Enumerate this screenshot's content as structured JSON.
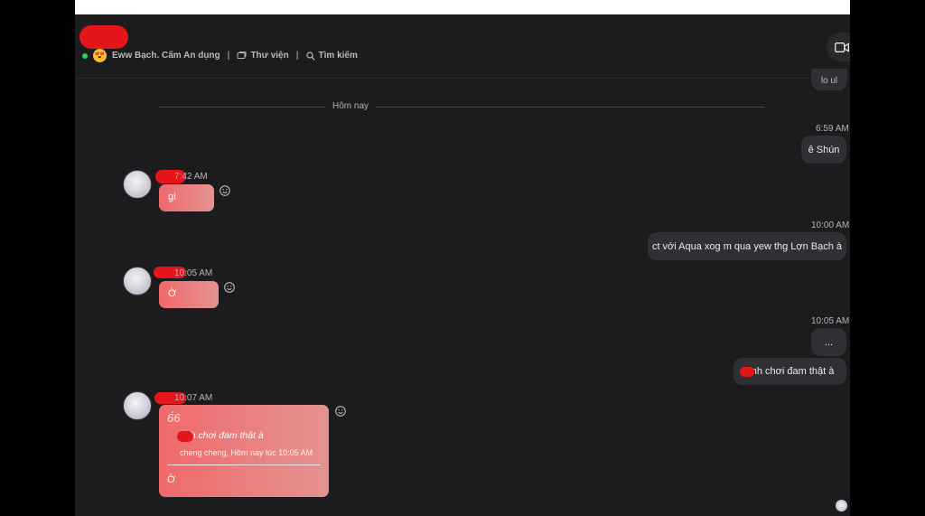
{
  "header": {
    "status": "Eww Bạch. Cấm An dụng",
    "status_emoji": "😍",
    "separator": "|",
    "library_label": "Thư viện",
    "search_label": "Tìm kiếm",
    "partial_message": "lo ul"
  },
  "date_divider": "Hôm nay",
  "messages": {
    "m1_time": "6:59 AM",
    "m1_text": "ê Shún",
    "m2_time": "7:42 AM",
    "m2_text": "gì",
    "m3_time": "10:00 AM",
    "m3_text": "ct với Aqua xog m qua yew thg Lợn Bạch à",
    "m4_time": "10:05 AM",
    "m4_text": "Ờ",
    "m5_time": "10:05 AM",
    "m5_text": "...",
    "m6_text": "tính chơi đam thật à",
    "m7_time": "10:07 AM",
    "m7_quote_mark": "6́6",
    "m7_quote_text": "tính chơi đam thật à",
    "m7_quote_meta": "cheng cheng, Hôm nay lúc 10:05 AM",
    "m7_text": "Ờ"
  },
  "colors": {
    "background": "#1c1c1e",
    "outgoing_bubble": "#303034",
    "incoming_gradient_start": "#f0696b",
    "incoming_gradient_end": "#e49391",
    "online": "#2fd057",
    "redaction": "#e4161b"
  },
  "icons": {
    "online": "online-dot",
    "library": "library-icon",
    "search": "search-icon",
    "video": "video-call-icon",
    "reaction": "smiley-reaction-icon"
  }
}
